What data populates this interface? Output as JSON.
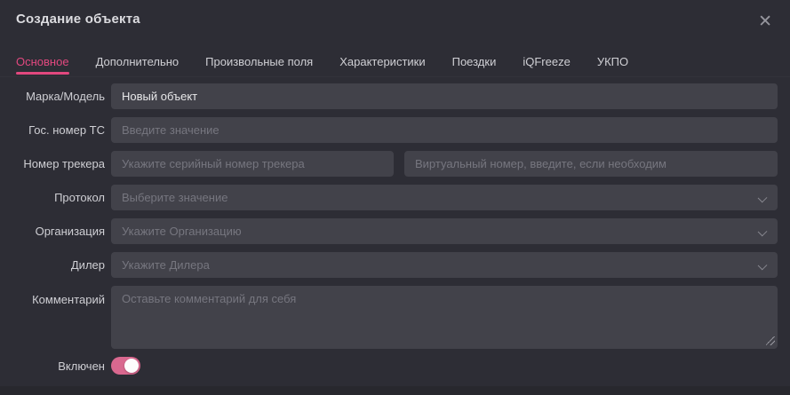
{
  "modal": {
    "title": "Создание объекта",
    "close_icon": "✕"
  },
  "tabs": [
    {
      "label": "Основное",
      "active": true
    },
    {
      "label": "Дополнительно",
      "active": false
    },
    {
      "label": "Произвольные поля",
      "active": false
    },
    {
      "label": "Характеристики",
      "active": false
    },
    {
      "label": "Поездки",
      "active": false
    },
    {
      "label": "iQFreeze",
      "active": false
    },
    {
      "label": "УКПО",
      "active": false
    }
  ],
  "form": {
    "brand_model": {
      "label": "Марка/Модель",
      "value": "Новый объект"
    },
    "gov_number": {
      "label": "Гос. номер ТС",
      "placeholder": "Введите значение"
    },
    "tracker": {
      "label": "Номер трекера",
      "serial_placeholder": "Укажите серийный номер трекера",
      "virtual_placeholder": "Виртуальный номер, введите, если необходим"
    },
    "protocol": {
      "label": "Протокол",
      "placeholder": "Выберите значение"
    },
    "organization": {
      "label": "Организация",
      "placeholder": "Укажите Организацию"
    },
    "dealer": {
      "label": "Дилер",
      "placeholder": "Укажите Дилера"
    },
    "comment": {
      "label": "Комментарий",
      "placeholder": "Оставьте комментарий для себя"
    },
    "enabled": {
      "label": "Включен",
      "state": "on"
    }
  },
  "colors": {
    "accent_pink": "#e1487f",
    "toggle_pink": "#d9688f",
    "modal_bg": "#2d2d35",
    "input_bg": "#42424a",
    "page_bg": "#28282e"
  }
}
